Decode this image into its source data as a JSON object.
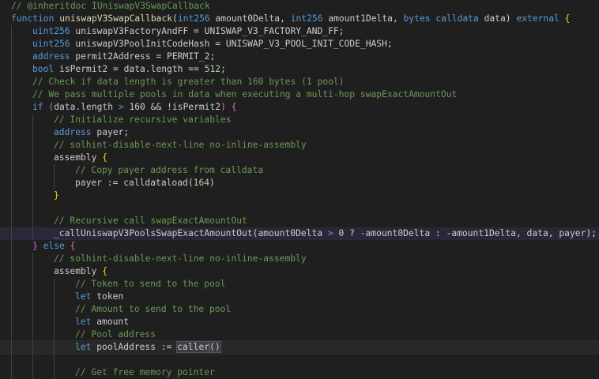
{
  "editor": {
    "language": "solidity",
    "theme": "dark",
    "lines": [
      {
        "indent": 0,
        "tokens": [
          {
            "t": "// @inheritdoc IUniswapV3SwapCallback",
            "c": "comment"
          }
        ]
      },
      {
        "indent": 0,
        "tokens": [
          {
            "t": "function ",
            "c": "keyword"
          },
          {
            "t": "uniswapV3SwapCallback",
            "c": "func"
          },
          {
            "t": "(",
            "c": "op"
          },
          {
            "t": "int256 ",
            "c": "keyword"
          },
          {
            "t": "amount0Delta",
            "c": "plain"
          },
          {
            "t": ", ",
            "c": "op"
          },
          {
            "t": "int256 ",
            "c": "keyword"
          },
          {
            "t": "amount1Delta",
            "c": "plain"
          },
          {
            "t": ", ",
            "c": "op"
          },
          {
            "t": "bytes ",
            "c": "keyword"
          },
          {
            "t": "calldata ",
            "c": "keyword"
          },
          {
            "t": "data",
            "c": "plain"
          },
          {
            "t": ") ",
            "c": "op"
          },
          {
            "t": "external ",
            "c": "keyword"
          },
          {
            "t": "{",
            "c": "bracket"
          }
        ]
      },
      {
        "indent": 1,
        "tokens": [
          {
            "t": "uint256 ",
            "c": "keyword"
          },
          {
            "t": "uniswapV3FactoryAndFF = UNISWAP_V3_FACTORY_AND_FF;",
            "c": "plain"
          }
        ]
      },
      {
        "indent": 1,
        "tokens": [
          {
            "t": "uint256 ",
            "c": "keyword"
          },
          {
            "t": "uniswapV3PoolInitCodeHash = UNISWAP_V3_POOL_INIT_CODE_HASH;",
            "c": "plain"
          }
        ]
      },
      {
        "indent": 1,
        "tokens": [
          {
            "t": "address ",
            "c": "keyword"
          },
          {
            "t": "permit2Address = PERMIT_2;",
            "c": "plain"
          }
        ]
      },
      {
        "indent": 1,
        "tokens": [
          {
            "t": "bool ",
            "c": "keyword"
          },
          {
            "t": "isPermit2 = data.length == ",
            "c": "plain"
          },
          {
            "t": "512",
            "c": "num"
          },
          {
            "t": ";",
            "c": "plain"
          }
        ]
      },
      {
        "indent": 1,
        "tokens": [
          {
            "t": "// Check if data length is greater than 160 bytes (1 pool)",
            "c": "comment"
          }
        ]
      },
      {
        "indent": 1,
        "tokens": [
          {
            "t": "// We pass multiple pools in data when executing a multi-hop swapExactAmountOut",
            "c": "comment"
          }
        ]
      },
      {
        "indent": 1,
        "tokens": [
          {
            "t": "if ",
            "c": "keyword"
          },
          {
            "t": "(",
            "c": "paren"
          },
          {
            "t": "data.length ",
            "c": "plain"
          },
          {
            "t": ">",
            "c": "keyword"
          },
          {
            "t": " 160 && !isPermit2",
            "c": "plain"
          },
          {
            "t": ")",
            "c": "paren"
          },
          {
            "t": " ",
            "c": "plain"
          },
          {
            "t": "{",
            "c": "paren"
          }
        ]
      },
      {
        "indent": 2,
        "tokens": [
          {
            "t": "// Initialize recursive variables",
            "c": "comment"
          }
        ]
      },
      {
        "indent": 2,
        "tokens": [
          {
            "t": "address ",
            "c": "keyword"
          },
          {
            "t": "payer;",
            "c": "plain"
          }
        ]
      },
      {
        "indent": 2,
        "tokens": [
          {
            "t": "// solhint-disable-next-line no-inline-assembly",
            "c": "comment"
          }
        ]
      },
      {
        "indent": 2,
        "tokens": [
          {
            "t": "assembly ",
            "c": "plain"
          },
          {
            "t": "{",
            "c": "bracket"
          }
        ]
      },
      {
        "indent": 3,
        "tokens": [
          {
            "t": "// Copy payer address from calldata",
            "c": "comment"
          }
        ]
      },
      {
        "indent": 3,
        "tokens": [
          {
            "t": "payer := calldataload",
            "c": "plain"
          },
          {
            "t": "(",
            "c": "op"
          },
          {
            "t": "164",
            "c": "num"
          },
          {
            "t": ")",
            "c": "op"
          }
        ]
      },
      {
        "indent": 2,
        "tokens": [
          {
            "t": "}",
            "c": "bracket"
          }
        ]
      },
      {
        "indent": 2,
        "tokens": []
      },
      {
        "indent": 2,
        "tokens": [
          {
            "t": "// Recursive call swapExactAmountOut",
            "c": "comment"
          }
        ]
      },
      {
        "indent": 2,
        "highlight": true,
        "tokens": [
          {
            "t": "_callUniswapV3PoolsSwapExactAmountOut",
            "c": "plain"
          },
          {
            "t": "(",
            "c": "op"
          },
          {
            "t": "amount0Delta ",
            "c": "plain"
          },
          {
            "t": ">",
            "c": "keyword"
          },
          {
            "t": " 0 ? -amount0Delta : -amount1Delta, data, payer",
            "c": "plain"
          },
          {
            "t": ");",
            "c": "op"
          }
        ]
      },
      {
        "indent": 1,
        "tokens": [
          {
            "t": "} ",
            "c": "paren"
          },
          {
            "t": "else ",
            "c": "keyword"
          },
          {
            "t": "{",
            "c": "paren"
          }
        ]
      },
      {
        "indent": 2,
        "tokens": [
          {
            "t": "// solhint-disable-next-line no-inline-assembly",
            "c": "comment"
          }
        ]
      },
      {
        "indent": 2,
        "tokens": [
          {
            "t": "assembly ",
            "c": "plain"
          },
          {
            "t": "{",
            "c": "bracket"
          }
        ]
      },
      {
        "indent": 3,
        "tokens": [
          {
            "t": "// Token to send to the pool",
            "c": "comment"
          }
        ]
      },
      {
        "indent": 3,
        "tokens": [
          {
            "t": "let ",
            "c": "keyword"
          },
          {
            "t": "token",
            "c": "plain"
          }
        ]
      },
      {
        "indent": 3,
        "tokens": [
          {
            "t": "// Amount to send to the pool",
            "c": "comment"
          }
        ]
      },
      {
        "indent": 3,
        "tokens": [
          {
            "t": "let ",
            "c": "keyword"
          },
          {
            "t": "amount",
            "c": "plain"
          }
        ]
      },
      {
        "indent": 3,
        "tokens": [
          {
            "t": "// Pool address",
            "c": "comment"
          }
        ]
      },
      {
        "indent": 3,
        "current": true,
        "tokens": [
          {
            "t": "let ",
            "c": "keyword"
          },
          {
            "t": "poolAddress := ",
            "c": "plain"
          },
          {
            "t": "caller",
            "c": "sel"
          },
          {
            "t": "()",
            "c": "sel"
          }
        ]
      },
      {
        "indent": 3,
        "tokens": []
      },
      {
        "indent": 3,
        "tokens": [
          {
            "t": "// Get free memory pointer",
            "c": "comment"
          }
        ]
      }
    ]
  }
}
